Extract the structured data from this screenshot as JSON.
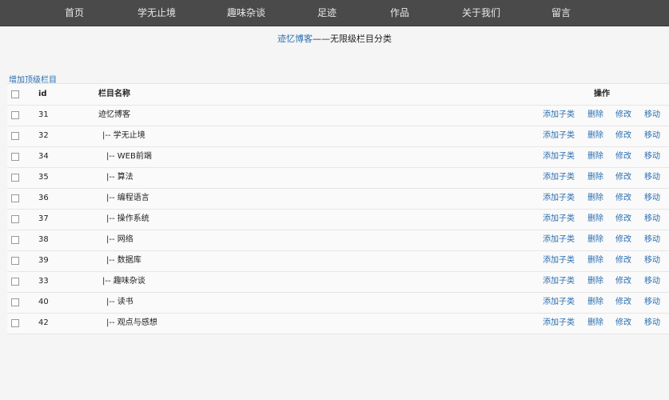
{
  "nav": [
    "首页",
    "学无止境",
    "趣味杂谈",
    "足迹",
    "作品",
    "关于我们",
    "留言"
  ],
  "subtitle": {
    "brand": "迹忆博客",
    "rest": "——无限级栏目分类"
  },
  "add_top_label": "增加顶级栏目",
  "table": {
    "headers": {
      "id": "id",
      "name": "栏目名称",
      "ops": "操作"
    },
    "op_labels": {
      "add": "添加子类",
      "delete": "删除",
      "edit": "修改",
      "move": "移动"
    },
    "rows": [
      {
        "id": "31",
        "name": "迹忆博客",
        "level": 0
      },
      {
        "id": "32",
        "name": "|-- 学无止境",
        "level": 1
      },
      {
        "id": "34",
        "name": "|-- WEB前端",
        "level": 2
      },
      {
        "id": "35",
        "name": "|-- 算法",
        "level": 2
      },
      {
        "id": "36",
        "name": "|-- 编程语言",
        "level": 2
      },
      {
        "id": "37",
        "name": "|-- 操作系统",
        "level": 2
      },
      {
        "id": "38",
        "name": "|-- 网络",
        "level": 2
      },
      {
        "id": "39",
        "name": "|-- 数据库",
        "level": 2
      },
      {
        "id": "33",
        "name": "|-- 趣味杂谈",
        "level": 1
      },
      {
        "id": "40",
        "name": "|-- 读书",
        "level": 2
      },
      {
        "id": "42",
        "name": "|-- 观点与感想",
        "level": 2
      }
    ]
  }
}
